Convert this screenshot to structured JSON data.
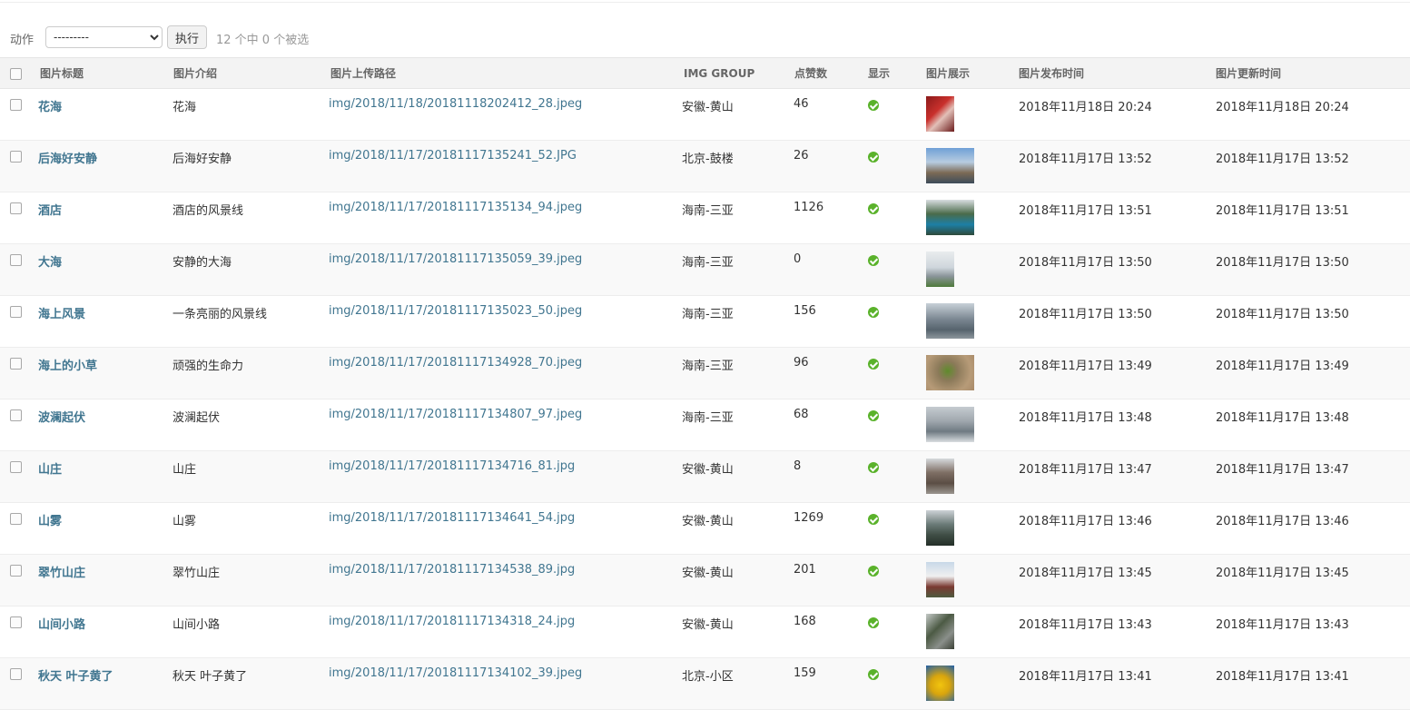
{
  "actions": {
    "label": "动作",
    "select_value": "---------",
    "go_label": "执行",
    "selection_counter": "12 个中 0 个被选"
  },
  "table": {
    "headers": {
      "title": "图片标题",
      "intro": "图片介绍",
      "path": "图片上传路径",
      "group": "IMG GROUP",
      "likes": "点赞数",
      "show": "显示",
      "preview": "图片展示",
      "published": "图片发布时间",
      "updated": "图片更新时间"
    },
    "rows": [
      {
        "title": "花海",
        "intro": "花海",
        "path": "img/2018/11/18/20181118202412_28.jpeg",
        "group": "安徽-黄山",
        "likes": "46",
        "published": "2018年11月18日 20:24",
        "updated": "2018年11月18日 20:24"
      },
      {
        "title": "后海好安静",
        "intro": "后海好安静",
        "path": "img/2018/11/17/20181117135241_52.JPG",
        "group": "北京-鼓楼",
        "likes": "26",
        "published": "2018年11月17日 13:52",
        "updated": "2018年11月17日 13:52"
      },
      {
        "title": "酒店",
        "intro": "酒店的风景线",
        "path": "img/2018/11/17/20181117135134_94.jpeg",
        "group": "海南-三亚",
        "likes": "1126",
        "published": "2018年11月17日 13:51",
        "updated": "2018年11月17日 13:51"
      },
      {
        "title": "大海",
        "intro": "安静的大海",
        "path": "img/2018/11/17/20181117135059_39.jpeg",
        "group": "海南-三亚",
        "likes": "0",
        "published": "2018年11月17日 13:50",
        "updated": "2018年11月17日 13:50"
      },
      {
        "title": "海上风景",
        "intro": "一条亮丽的风景线",
        "path": "img/2018/11/17/20181117135023_50.jpeg",
        "group": "海南-三亚",
        "likes": "156",
        "published": "2018年11月17日 13:50",
        "updated": "2018年11月17日 13:50"
      },
      {
        "title": "海上的小草",
        "intro": "顽强的生命力",
        "path": "img/2018/11/17/20181117134928_70.jpeg",
        "group": "海南-三亚",
        "likes": "96",
        "published": "2018年11月17日 13:49",
        "updated": "2018年11月17日 13:49"
      },
      {
        "title": "波澜起伏",
        "intro": "波澜起伏",
        "path": "img/2018/11/17/20181117134807_97.jpeg",
        "group": "海南-三亚",
        "likes": "68",
        "published": "2018年11月17日 13:48",
        "updated": "2018年11月17日 13:48"
      },
      {
        "title": "山庄",
        "intro": "山庄",
        "path": "img/2018/11/17/20181117134716_81.jpg",
        "group": "安徽-黄山",
        "likes": "8",
        "published": "2018年11月17日 13:47",
        "updated": "2018年11月17日 13:47"
      },
      {
        "title": "山雾",
        "intro": "山雾",
        "path": "img/2018/11/17/20181117134641_54.jpg",
        "group": "安徽-黄山",
        "likes": "1269",
        "published": "2018年11月17日 13:46",
        "updated": "2018年11月17日 13:46"
      },
      {
        "title": "翠竹山庄",
        "intro": "翠竹山庄",
        "path": "img/2018/11/17/20181117134538_89.jpg",
        "group": "安徽-黄山",
        "likes": "201",
        "published": "2018年11月17日 13:45",
        "updated": "2018年11月17日 13:45"
      },
      {
        "title": "山间小路",
        "intro": "山间小路",
        "path": "img/2018/11/17/20181117134318_24.jpg",
        "group": "安徽-黄山",
        "likes": "168",
        "published": "2018年11月17日 13:43",
        "updated": "2018年11月17日 13:43"
      },
      {
        "title": "秋天 叶子黄了",
        "intro": "秋天 叶子黄了",
        "path": "img/2018/11/17/20181117134102_39.jpeg",
        "group": "北京-小区",
        "likes": "159",
        "published": "2018年11月17日 13:41",
        "updated": "2018年11月17日 13:41"
      }
    ]
  },
  "colors": {
    "link": "#417690",
    "ok_icon": "#5ab22b",
    "header_bg": "#f3f3f3",
    "alt_row_bg": "#f9f9f9"
  },
  "icons": {
    "shown": "check-circle-icon",
    "select": "checkbox-icon"
  }
}
